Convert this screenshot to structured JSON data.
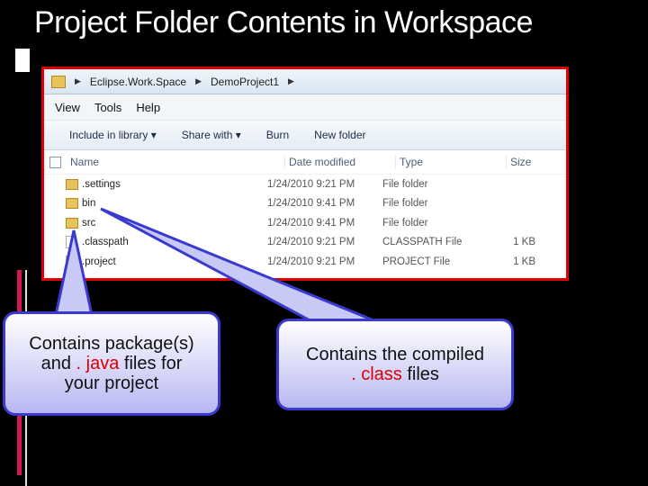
{
  "slide": {
    "title": "Project Folder Contents in Workspace"
  },
  "explorer": {
    "breadcrumb": [
      "Eclipse.Work.Space",
      "DemoProject1"
    ],
    "menu": [
      "View",
      "Tools",
      "Help"
    ],
    "toolbar": [
      "Include in library ▾",
      "Share with ▾",
      "Burn",
      "New folder"
    ],
    "columns": [
      "Name",
      "Date modified",
      "Type",
      "Size"
    ],
    "rows": [
      {
        "icon": "folder-icon",
        "name": ".settings",
        "date": "1/24/2010 9:21 PM",
        "type": "File folder",
        "size": ""
      },
      {
        "icon": "folder-icon",
        "name": "bin",
        "date": "1/24/2010 9:41 PM",
        "type": "File folder",
        "size": ""
      },
      {
        "icon": "folder-icon",
        "name": "src",
        "date": "1/24/2010 9:41 PM",
        "type": "File folder",
        "size": ""
      },
      {
        "icon": "file-icon",
        "name": ".classpath",
        "date": "1/24/2010 9:21 PM",
        "type": "CLASSPATH File",
        "size": "1 KB"
      },
      {
        "icon": "file-icon",
        "name": ".project",
        "date": "1/24/2010 9:21 PM",
        "type": "PROJECT File",
        "size": "1 KB"
      }
    ]
  },
  "callouts": {
    "src": {
      "line1": "Contains package(s)",
      "line2_pre": "and ",
      "line2_accent": ". java",
      "line2_post": " files for",
      "line3": "your project"
    },
    "bin": {
      "line1": "Contains the compiled",
      "line2_accent": ". class",
      "line2_post": " files"
    }
  },
  "colors": {
    "highlight_border": "#e00000",
    "callout_border": "#3a3ad0",
    "accent_text": "#d00000"
  }
}
